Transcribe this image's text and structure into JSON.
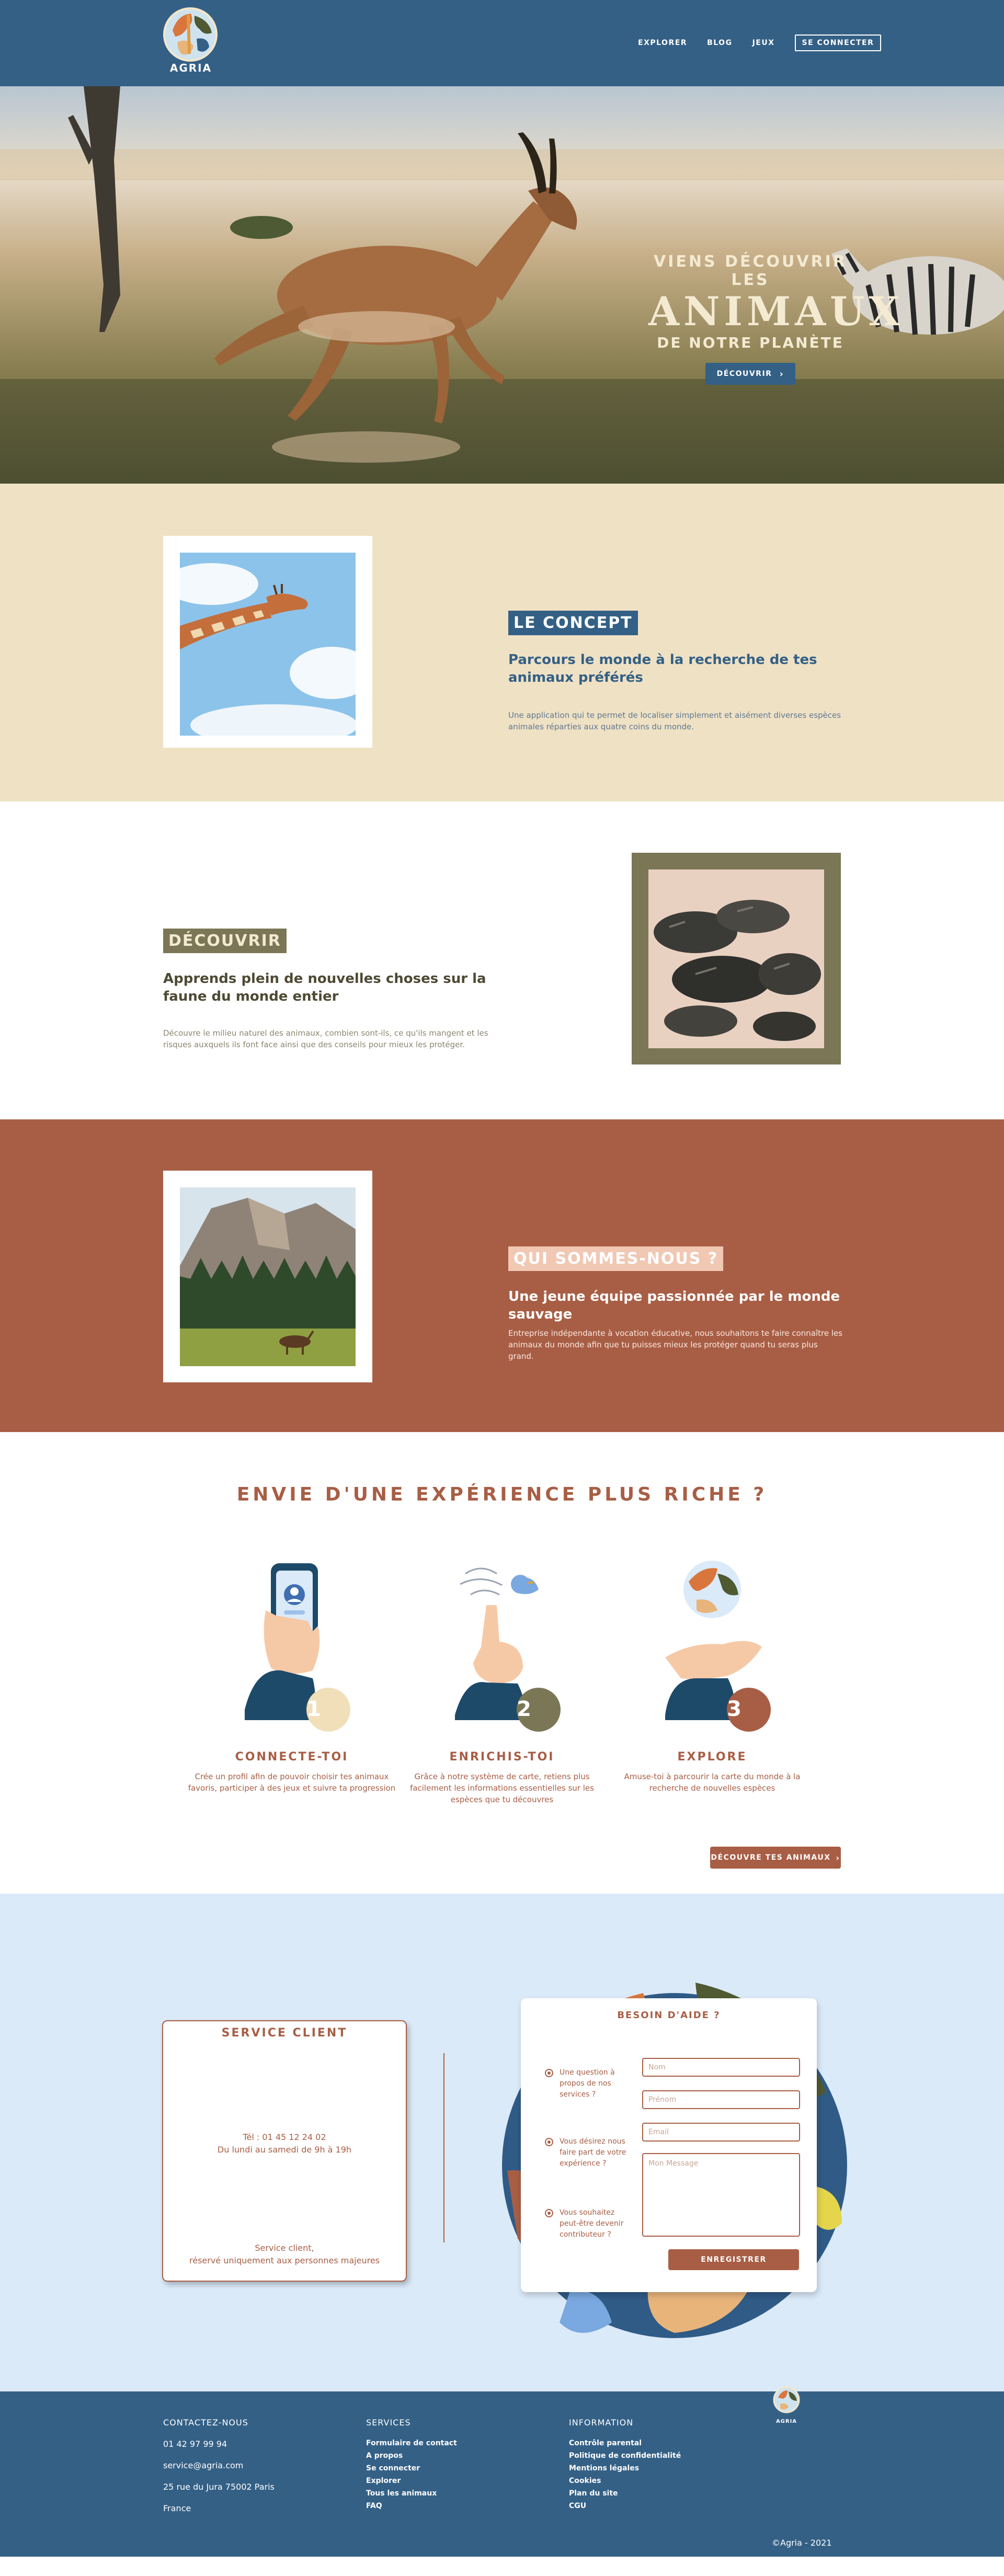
{
  "brand": {
    "name": "AGRIA"
  },
  "nav": {
    "items": [
      "Explorer",
      "Blog",
      "Jeux"
    ],
    "login": "Se connecter"
  },
  "hero": {
    "line1": "VIENS DÉCOUVRIR LES",
    "line2": "ANIMAUX",
    "line3": "DE NOTRE PLANÈTE",
    "button": "DÉCOUVRIR"
  },
  "concept": {
    "tag": "LE CONCEPT",
    "title": "Parcours le monde à la recherche de tes animaux préférés",
    "desc": "Une application qui te permet de localiser simplement et aisément diverses espèces animales réparties aux quatre coins du monde."
  },
  "decouvrir": {
    "tag": "DÉCOUVRIR",
    "title": "Apprends plein de nouvelles choses sur la faune du monde entier",
    "desc": "Découvre le milieu naturel des animaux, combien sont-ils, ce qu'ils mangent et les risques auxquels ils font face ainsi que des conseils pour mieux les protéger."
  },
  "about": {
    "tag": "QUI SOMMES-NOUS ?",
    "title": "Une jeune équipe passionnée par le monde sauvage",
    "desc": "Entreprise indépendante à vocation éducative, nous souhaitons te faire connaître les animaux du monde afin que tu puisses mieux les protéger quand tu seras plus grand."
  },
  "experience": {
    "title": "ENVIE D'UNE EXPÉRIENCE PLUS RICHE ?",
    "steps": [
      {
        "num": "1",
        "title": "CONNECTE-TOI",
        "desc": "Crée un profil afin de pouvoir choisir tes animaux favoris, participer à des jeux et suivre ta progression"
      },
      {
        "num": "2",
        "title": "ENRICHIS-TOI",
        "desc": "Grâce à notre système de carte, retiens plus facilement les informations essentielles sur les espèces que tu découvres"
      },
      {
        "num": "3",
        "title": "EXPLORE",
        "desc": "Amuse-toi à parcourir la carte du monde à la recherche de nouvelles espèces"
      }
    ],
    "button": "DÉCOUVRE TES ANIMAUX"
  },
  "service": {
    "title": "SERVICE CLIENT",
    "phone": "Tél : 01 45 12 24 02",
    "hours": "Du lundi au samedi de 9h à 19h",
    "note1": "Service client,",
    "note2": "réservé uniquement aux personnes majeures"
  },
  "form": {
    "title": "BESOIN D'AIDE ?",
    "options": [
      "Une question à propos de nos services ?",
      "Vous désirez nous faire part de votre expérience ?",
      "Vous souhaitez peut-être devenir contributeur ?"
    ],
    "placeholders": {
      "nom": "Nom",
      "prenom": "Prénom",
      "email": "Email",
      "message": "Mon Message"
    },
    "submit": "ENREGISTRER"
  },
  "footer": {
    "contact_head": "CONTACTEZ-NOUS",
    "phone": "01 42 97 99 94",
    "email": "service@agria.com",
    "address": "25 rue du Jura 75002 Paris",
    "country": "France",
    "services_head": "SERVICES",
    "services": [
      "Formulaire de contact",
      "A propos",
      "Se connecter",
      "Explorer",
      "Tous les animaux",
      "FAQ"
    ],
    "info_head": "INFORMATION",
    "info": [
      "Contrôle parental",
      "Politique de confidentialité",
      "Mentions légales",
      "Cookies",
      "Plan du site",
      "CGU"
    ],
    "copyright": "©Agria - 2021",
    "logo_text": "AGRIA"
  },
  "colors": {
    "header_blue": "#346086",
    "beige": "#efe1c4",
    "terracotta": "#a85e45",
    "olive": "#7b7656",
    "light_blue": "#dbeaf9"
  }
}
